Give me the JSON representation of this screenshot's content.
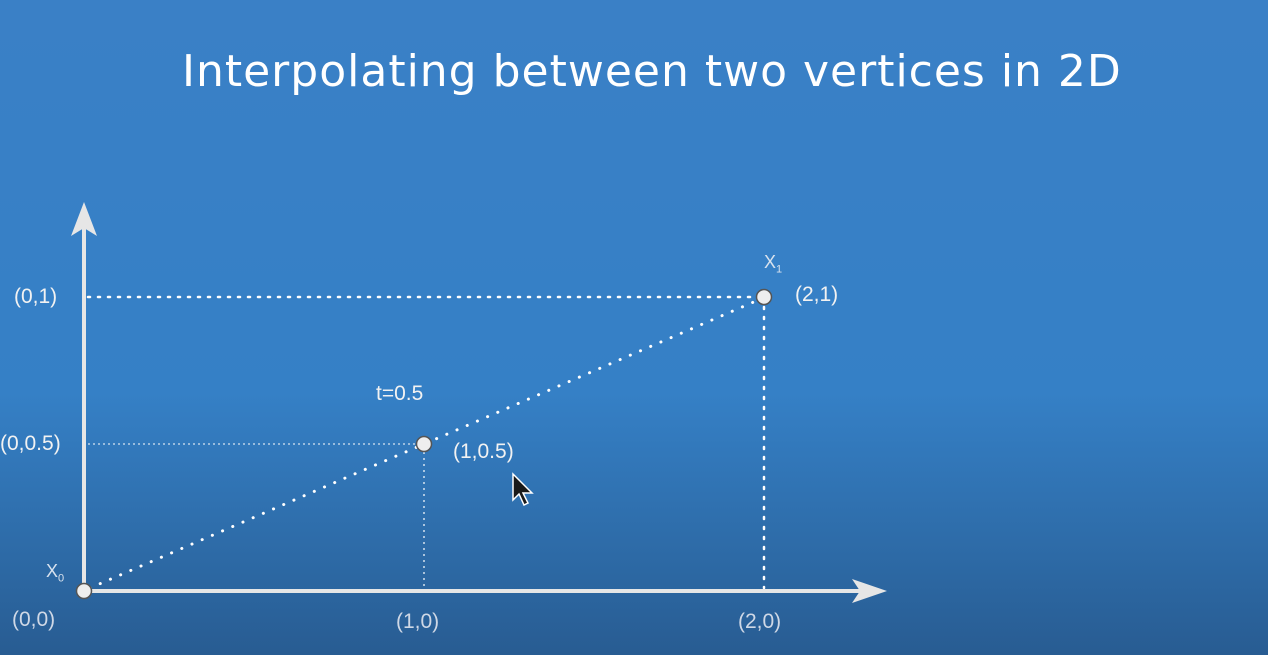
{
  "title": "Interpolating between two vertices in 2D",
  "colors": {
    "axis": "#e6e6e6",
    "dots": "#ffffff",
    "point_fill": "#eeeeee",
    "point_stroke": "#555555"
  },
  "axes": {
    "x_ticks": [
      {
        "value": 0,
        "label": "(0,0)"
      },
      {
        "value": 1,
        "label": "(1,0)"
      },
      {
        "value": 2,
        "label": "(2,0)"
      }
    ],
    "y_ticks": [
      {
        "value": 0.5,
        "label": "(0,0.5)"
      },
      {
        "value": 1,
        "label": "(0,1)"
      }
    ]
  },
  "points": {
    "x0": {
      "x": 0,
      "y": 0,
      "name": "X",
      "sub": "0"
    },
    "mid": {
      "x": 1,
      "y": 0.5,
      "label": "(1,0.5)",
      "t_label": "t=0.5"
    },
    "x1": {
      "x": 2,
      "y": 1,
      "name": "X",
      "sub": "1",
      "label": "(2,1)"
    }
  },
  "cursor": "arrow-cursor-icon"
}
